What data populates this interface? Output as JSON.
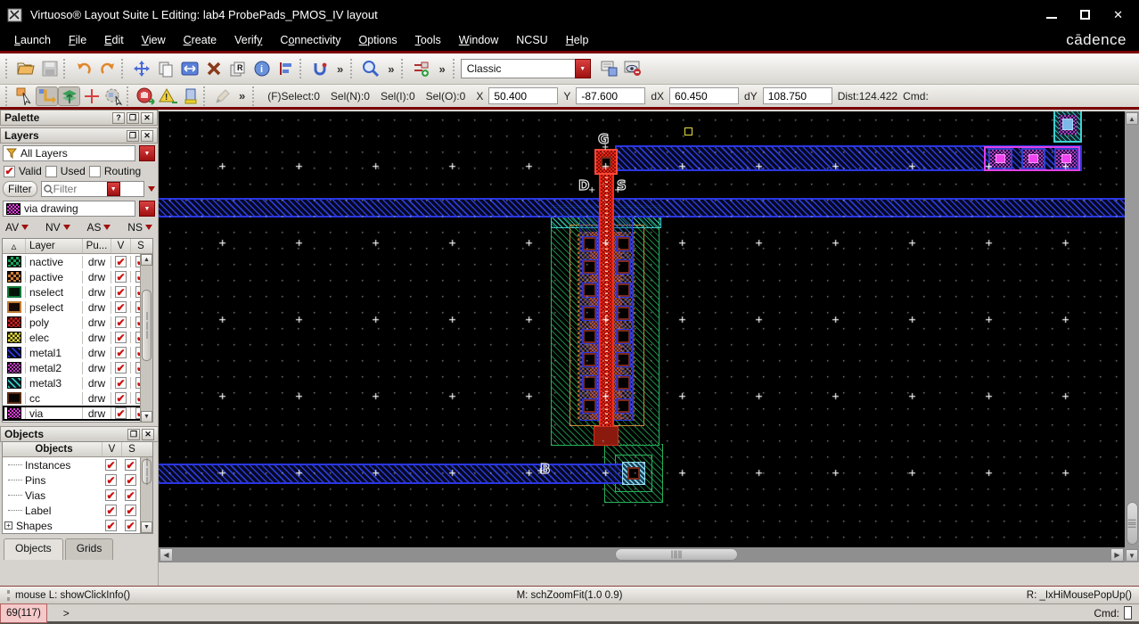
{
  "window": {
    "title": "Virtuoso® Layout Suite L Editing: lab4 ProbePads_PMOS_IV layout"
  },
  "menubar": {
    "items": [
      {
        "label": "Launch"
      },
      {
        "label": "File"
      },
      {
        "label": "Edit"
      },
      {
        "label": "View"
      },
      {
        "label": "Create"
      },
      {
        "label": "Verify"
      },
      {
        "label": "Connectivity"
      },
      {
        "label": "Options"
      },
      {
        "label": "Tools"
      },
      {
        "label": "Window"
      },
      {
        "label": "NCSU"
      },
      {
        "label": "Help"
      }
    ],
    "brand": "cādence"
  },
  "toolbar": {
    "workspace_combo_value": "Classic",
    "overflow_glyph": "»"
  },
  "coords": {
    "fselect": "(F)Select:0",
    "sel_n": "Sel(N):0",
    "sel_i": "Sel(I):0",
    "sel_o": "Sel(O):0",
    "x_label": "X",
    "x_value": "50.400",
    "y_label": "Y",
    "y_value": "-87.600",
    "dx_label": "dX",
    "dx_value": "60.450",
    "dy_label": "dY",
    "dy_value": "108.750",
    "dist": "Dist:124.422",
    "cmd": "Cmd:"
  },
  "palette": {
    "title": "Palette",
    "help_btn": "?",
    "layers_title": "Layers",
    "all_layers": "All Layers",
    "valid": "Valid",
    "used": "Used",
    "routing": "Routing",
    "filter_button": "Filter",
    "filter_placeholder": "Filter",
    "active_layer": "via drawing",
    "av": "AV",
    "nv": "NV",
    "as": "AS",
    "ns": "NS",
    "headers": {
      "layer": "Layer",
      "purpose": "Pu...",
      "v": "V",
      "s": "S"
    },
    "rows": [
      {
        "name": "nactive",
        "purpose": "drw"
      },
      {
        "name": "pactive",
        "purpose": "drw"
      },
      {
        "name": "nselect",
        "purpose": "drw"
      },
      {
        "name": "pselect",
        "purpose": "drw"
      },
      {
        "name": "poly",
        "purpose": "drw"
      },
      {
        "name": "elec",
        "purpose": "drw"
      },
      {
        "name": "metal1",
        "purpose": "drw"
      },
      {
        "name": "metal2",
        "purpose": "drw"
      },
      {
        "name": "metal3",
        "purpose": "drw"
      },
      {
        "name": "cc",
        "purpose": "drw"
      },
      {
        "name": "via",
        "purpose": "drw"
      }
    ]
  },
  "objects_panel": {
    "title": "Objects",
    "col_objects": "Objects",
    "col_v": "V",
    "col_s": "S",
    "rows": [
      {
        "name": "Instances"
      },
      {
        "name": "Pins"
      },
      {
        "name": "Vias"
      },
      {
        "name": "Label"
      },
      {
        "name": "Shapes"
      }
    ]
  },
  "bottom_tabs": {
    "objects": "Objects",
    "grids": "Grids"
  },
  "canvas": {
    "pin_labels": {
      "gate": "G",
      "drain": "D",
      "source": "S",
      "bulk": "B"
    }
  },
  "statusbar": {
    "left": "mouse L: showClickInfo()",
    "middle": "M: schZoomFit(1.0 0.9)",
    "right": "R: _IxHiMousePopUp()"
  },
  "prompt": {
    "badge": "69(117)",
    "caret": ">",
    "cmd": "Cmd:"
  },
  "colors": {
    "accent_red": "#a01010",
    "metal1": "#2a36e0",
    "metal2": "#e33fe3",
    "metal3": "#3fd0d0",
    "nwell_green": "#27b35e",
    "poly_red": "#ff2a16",
    "pselect_orange": "#c8883a"
  }
}
